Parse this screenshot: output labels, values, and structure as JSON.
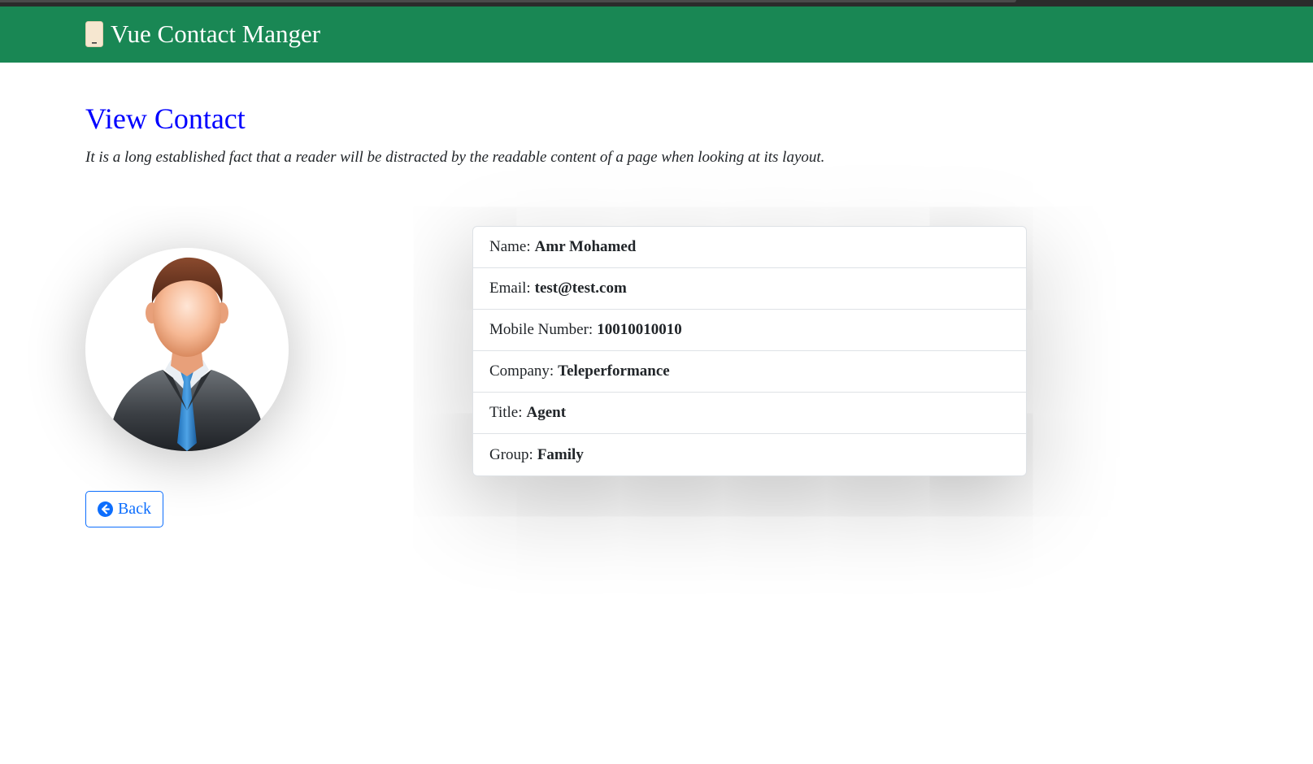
{
  "navbar": {
    "brand_icon": "mobile-phone-icon",
    "brand_text": "Vue Contact Manger",
    "background": "#198754"
  },
  "page": {
    "title": "View Contact",
    "description": "It is a long established fact that a reader will be distracted by the readable content of a page when looking at its layout.",
    "title_color": "#0000ff"
  },
  "avatar": {
    "icon": "businessman-avatar"
  },
  "contact": {
    "fields": [
      {
        "label": "Name:",
        "value": "Amr Mohamed"
      },
      {
        "label": "Email:",
        "value": "test@test.com"
      },
      {
        "label": "Mobile Number:",
        "value": "10010010010"
      },
      {
        "label": "Company:",
        "value": "Teleperformance"
      },
      {
        "label": "Title:",
        "value": "Agent"
      },
      {
        "label": "Group:",
        "value": "Family"
      }
    ]
  },
  "back_button": {
    "label": "Back",
    "icon": "arrow-circle-left-icon",
    "color": "#0d6efd"
  }
}
